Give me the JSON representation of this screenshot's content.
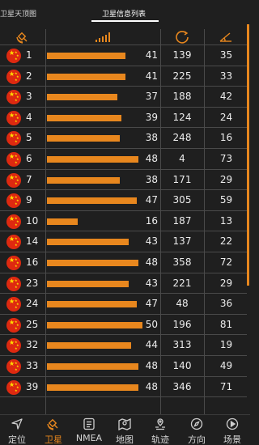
{
  "tabs": {
    "left": "卫星天顶图",
    "center": "卫星信息列表"
  },
  "header_icons": [
    "satellite-icon",
    "signal-icon",
    "azimuth-icon",
    "elevation-icon"
  ],
  "colors": {
    "accent": "#e8871e",
    "background": "#1f1f1f",
    "grid": "#4a4a4a",
    "flag": "#de2910"
  },
  "rows": [
    {
      "id": "1",
      "snr": "41",
      "azimuth": "139",
      "elevation": "35",
      "snr_value": 41
    },
    {
      "id": "2",
      "snr": "41",
      "azimuth": "225",
      "elevation": "33",
      "snr_value": 41
    },
    {
      "id": "3",
      "snr": "37",
      "azimuth": "188",
      "elevation": "42",
      "snr_value": 37
    },
    {
      "id": "4",
      "snr": "39",
      "azimuth": "124",
      "elevation": "24",
      "snr_value": 39
    },
    {
      "id": "5",
      "snr": "38",
      "azimuth": "248",
      "elevation": "16",
      "snr_value": 38
    },
    {
      "id": "6",
      "snr": "48",
      "azimuth": "4",
      "elevation": "73",
      "snr_value": 48
    },
    {
      "id": "7",
      "snr": "38",
      "azimuth": "171",
      "elevation": "29",
      "snr_value": 38
    },
    {
      "id": "9",
      "snr": "47",
      "azimuth": "305",
      "elevation": "59",
      "snr_value": 47
    },
    {
      "id": "10",
      "snr": "16",
      "azimuth": "187",
      "elevation": "13",
      "snr_value": 16
    },
    {
      "id": "14",
      "snr": "43",
      "azimuth": "137",
      "elevation": "22",
      "snr_value": 43
    },
    {
      "id": "16",
      "snr": "48",
      "azimuth": "358",
      "elevation": "72",
      "snr_value": 48
    },
    {
      "id": "23",
      "snr": "43",
      "azimuth": "221",
      "elevation": "29",
      "snr_value": 43
    },
    {
      "id": "24",
      "snr": "47",
      "azimuth": "48",
      "elevation": "36",
      "snr_value": 47
    },
    {
      "id": "25",
      "snr": "50",
      "azimuth": "196",
      "elevation": "81",
      "snr_value": 50
    },
    {
      "id": "32",
      "snr": "44",
      "azimuth": "313",
      "elevation": "19",
      "snr_value": 44
    },
    {
      "id": "33",
      "snr": "48",
      "azimuth": "140",
      "elevation": "49",
      "snr_value": 48
    },
    {
      "id": "39",
      "snr": "48",
      "azimuth": "346",
      "elevation": "71",
      "snr_value": 48
    }
  ],
  "nav": [
    {
      "label": "定位",
      "icon": "locate-icon",
      "active": false
    },
    {
      "label": "卫星",
      "icon": "satellite-icon",
      "active": true
    },
    {
      "label": "NMEA",
      "icon": "document-icon",
      "active": false
    },
    {
      "label": "地图",
      "icon": "map-icon",
      "active": false
    },
    {
      "label": "轨迹",
      "icon": "track-icon",
      "active": false
    },
    {
      "label": "方向",
      "icon": "compass-icon",
      "active": false
    },
    {
      "label": "场景",
      "icon": "play-icon",
      "active": false
    }
  ]
}
